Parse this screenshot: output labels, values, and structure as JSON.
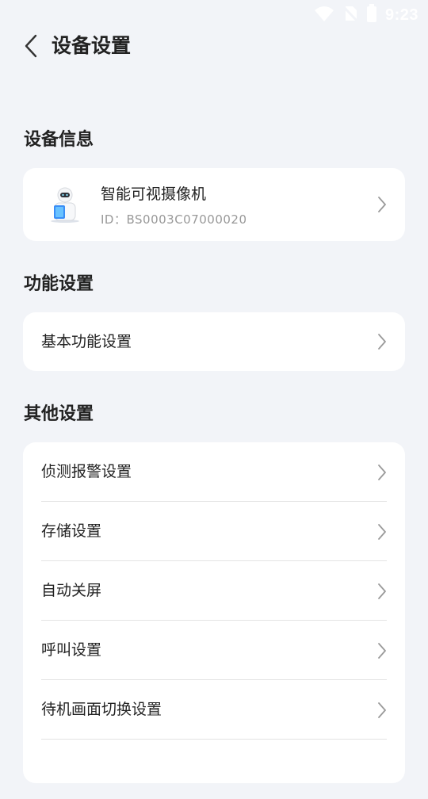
{
  "status_bar": {
    "time": "9:23",
    "icons": [
      "wifi-icon",
      "no-sim-icon",
      "battery-icon"
    ]
  },
  "header": {
    "title": "设备设置",
    "back_icon": "chevron-left-icon"
  },
  "sections": {
    "device_info": {
      "title": "设备信息",
      "device": {
        "name": "智能可视摄像机",
        "id_text": "ID：BS0003C07000020",
        "thumbnail_icon": "robot-camera-icon"
      }
    },
    "function_settings": {
      "title": "功能设置",
      "items": [
        {
          "label": "基本功能设置"
        }
      ]
    },
    "other_settings": {
      "title": "其他设置",
      "items": [
        {
          "label": "侦测报警设置"
        },
        {
          "label": "存储设置"
        },
        {
          "label": "自动关屏"
        },
        {
          "label": "呼叫设置"
        },
        {
          "label": "待机画面切换设置"
        },
        {
          "label": ""
        }
      ]
    }
  },
  "colors": {
    "background": "#f2f4f8",
    "card": "#ffffff",
    "primary_text": "#222222",
    "secondary_text": "#999999",
    "chevron": "#9a9a9a"
  }
}
